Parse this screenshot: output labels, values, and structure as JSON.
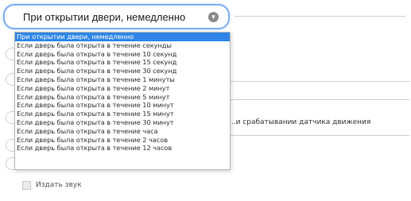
{
  "trigger_select": {
    "selected_label": "При открытии двери, немедленно",
    "options": [
      "При открытии двери, немедленно",
      "Если дверь была открыта в течение секунды",
      "Если дверь была открыта в течение 10 секунд",
      "Если дверь была открыта в течение 15 секунд",
      "Если дверь была открыта в течение 30 секунд",
      "Если дверь была открыта в течение 1 минуты",
      "Если дверь была открыта в течение 2 минут",
      "Если дверь была открыта в течение 5 минут",
      "Если дверь была открыта в течение 10 минут",
      "Если дверь была открыта в течение 15 минут",
      "Если дверь была открыта в течение 30 минут",
      "Если дверь была открыта в течение часа",
      "Если дверь была открыта в течение 2 часов",
      "Если дверь была открыта в течение 12 часов"
    ]
  },
  "background": {
    "motion_text": "...и срабатывании датчика движения"
  },
  "sound_checkbox": {
    "label": "Издать звук",
    "checked": false
  }
}
